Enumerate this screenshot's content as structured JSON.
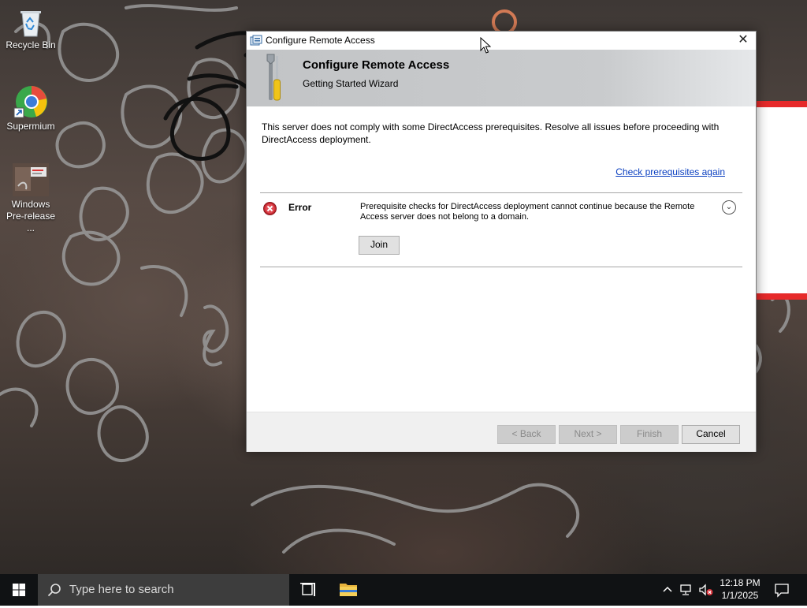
{
  "desktop": {
    "icons": [
      {
        "label": "Recycle Bin",
        "icon": "recycle-bin-icon"
      },
      {
        "label": "Supermium",
        "icon": "supermium-browser-icon"
      },
      {
        "label_line1": "Windows",
        "label_line2": "Pre-release ...",
        "icon": "windows-prerelease-image-icon"
      }
    ]
  },
  "dialog": {
    "window_title": "Configure Remote Access",
    "banner_title": "Configure Remote Access",
    "banner_subtitle": "Getting Started Wizard",
    "intro_text": "This server does not comply with some DirectAccess prerequisites. Resolve all issues before proceeding with DirectAccess deployment.",
    "recheck_link": "Check prerequisites again",
    "error": {
      "label": "Error",
      "message": "Prerequisite checks for DirectAccess deployment cannot continue because the Remote Access server does not belong to a domain.",
      "action_button": "Join"
    },
    "buttons": {
      "back": "< Back",
      "next": "Next >",
      "finish": "Finish",
      "cancel": "Cancel"
    }
  },
  "taskbar": {
    "search_placeholder": "Type here to search",
    "time": "12:18 PM",
    "date": "1/1/2025"
  },
  "colors": {
    "taskbar_bg": "#101214",
    "search_bg": "#3d3d3d",
    "link": "#0a3fc0",
    "error_red": "#c4262e",
    "accent_red_frame": "#e62a2a"
  }
}
